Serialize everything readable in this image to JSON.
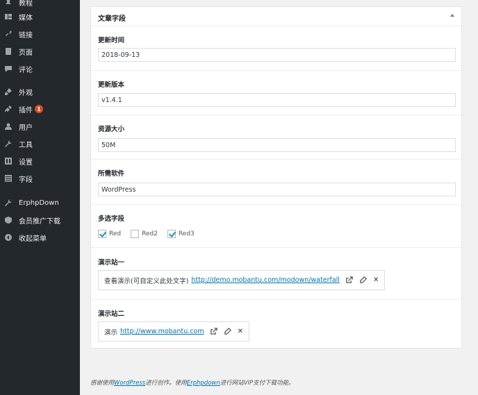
{
  "sidebar": {
    "items": [
      {
        "label": "教程",
        "icon": "pin-icon"
      },
      {
        "label": "媒体",
        "icon": "media-icon"
      },
      {
        "label": "链接",
        "icon": "link-icon"
      },
      {
        "label": "页面",
        "icon": "page-icon"
      },
      {
        "label": "评论",
        "icon": "comment-icon"
      },
      {
        "label": "外观",
        "icon": "brush-icon"
      },
      {
        "label": "插件",
        "icon": "plugin-icon",
        "badge": "1"
      },
      {
        "label": "用户",
        "icon": "user-icon"
      },
      {
        "label": "工具",
        "icon": "wrench-icon"
      },
      {
        "label": "设置",
        "icon": "settings-icon"
      },
      {
        "label": "字段",
        "icon": "fields-icon"
      },
      {
        "label": "ErphpDown",
        "icon": "wrench-icon"
      },
      {
        "label": "会员推广下载",
        "icon": "shield-icon"
      },
      {
        "label": "收起菜单",
        "icon": "collapse-icon"
      }
    ]
  },
  "panel": {
    "title": "文章字段",
    "fields": {
      "update_time": {
        "label": "更新时间",
        "value": "2018-09-13"
      },
      "version": {
        "label": "更新版本",
        "value": "v1.4.1"
      },
      "size": {
        "label": "资源大小",
        "value": "50M"
      },
      "software": {
        "label": "所需软件",
        "value": "WordPress"
      }
    },
    "multi": {
      "label": "多选字段",
      "options": [
        {
          "label": "Red",
          "checked": true
        },
        {
          "label": "Red2",
          "checked": false
        },
        {
          "label": "Red3",
          "checked": true
        }
      ]
    },
    "demo1": {
      "label": "演示站一",
      "text": "查看演示(可自定义此处文字)",
      "url": "http://demo.mobantu.com/modown/waterfall"
    },
    "demo2": {
      "label": "演示站二",
      "text": "演示",
      "url": "http://www.mobantu.com"
    }
  },
  "footer": {
    "prefix": "感谢使用",
    "wp_link": "WordPress",
    "middle": "进行创作。使用",
    "erphp_link": "Erphpdown",
    "suffix": "进行网站VIP支付下载功能。"
  }
}
